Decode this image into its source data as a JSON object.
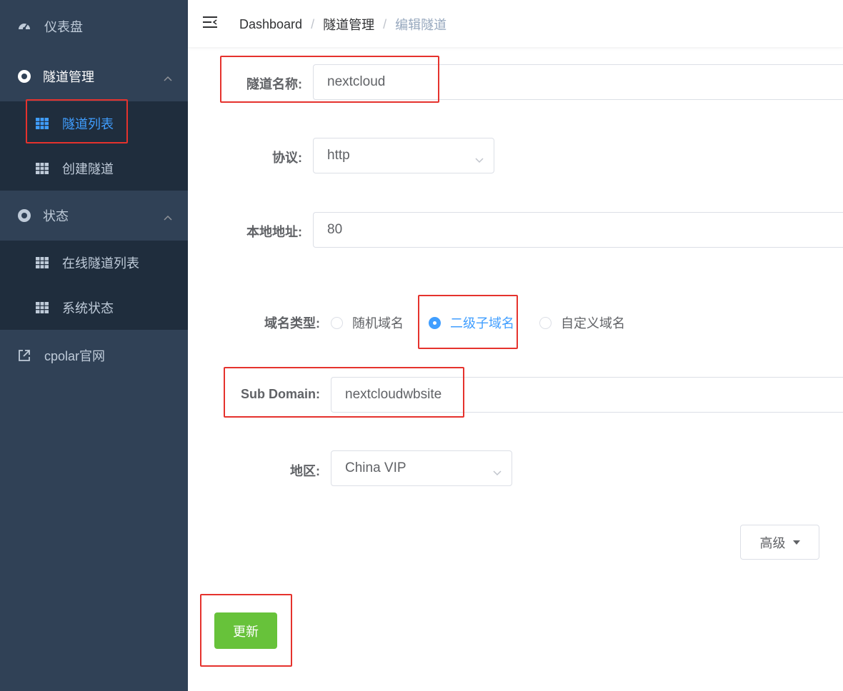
{
  "sidebar": {
    "dashboard": "仪表盘",
    "tunnel_mgmt": "隧道管理",
    "tunnel_list": "隧道列表",
    "create_tunnel": "创建隧道",
    "status": "状态",
    "online_tunnels": "在线隧道列表",
    "system_status": "系统状态",
    "cpolar_site": "cpolar官网"
  },
  "breadcrumb": {
    "home": "Dashboard",
    "section": "隧道管理",
    "current": "编辑隧道",
    "separator": "/"
  },
  "form": {
    "tunnel_name_label": "隧道名称:",
    "tunnel_name_value": "nextcloud",
    "protocol_label": "协议:",
    "protocol_value": "http",
    "local_addr_label": "本地地址:",
    "local_addr_value": "80",
    "domain_type_label": "域名类型:",
    "domain_type_options": [
      "随机域名",
      "二级子域名",
      "自定义域名"
    ],
    "domain_type_selected": "二级子域名",
    "subdomain_label": "Sub Domain:",
    "subdomain_value": "nextcloudwbsite",
    "region_label": "地区:",
    "region_value": "China VIP",
    "advanced_label": "高级",
    "submit_label": "更新"
  },
  "colors": {
    "sidebar_bg": "#304156",
    "submenu_bg": "#1f2d3d",
    "accent": "#409eff",
    "submit": "#67c23a",
    "highlight": "#e5322d"
  },
  "icons": [
    "gauge-icon",
    "lifebuoy-icon",
    "table-icon",
    "external-link-icon",
    "hamburger-icon",
    "chevron-up-icon",
    "chevron-down-icon",
    "caret-down-icon"
  ]
}
